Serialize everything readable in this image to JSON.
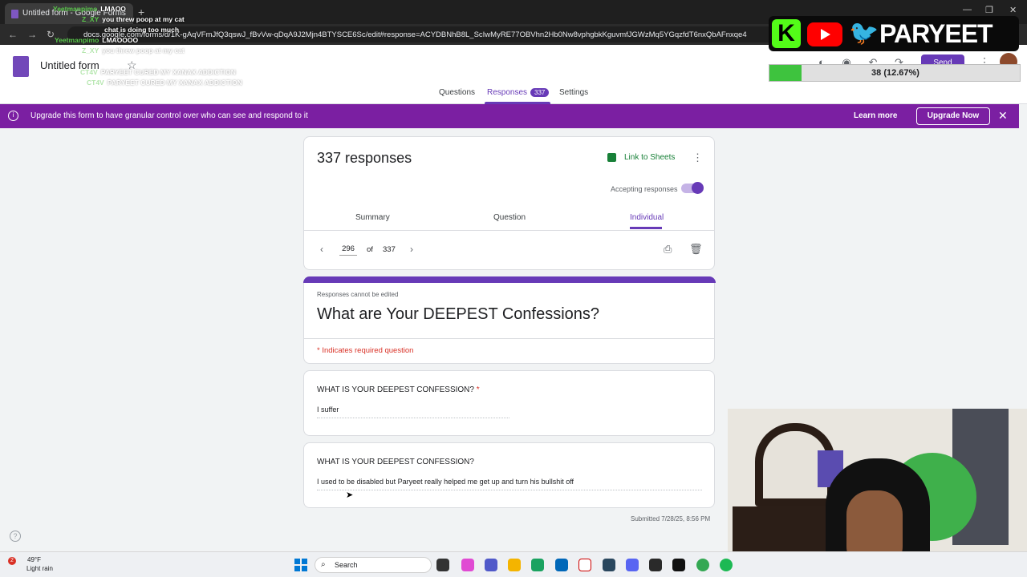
{
  "browser": {
    "tab_title": "Untitled form - Google Forms",
    "url": "docs.google.com/forms/d/1K-gAqVFmJfQ3qswJ_fBvVw-qDqA9J2Mjn4BTYSCE6Sc/edit#response=ACYDBNhB8L_ScIwMyRE77OBVhn2Hb0Nw8vphgbkKguvmfJGWzMq5YGqzfdT6nxQbAFnxqe4"
  },
  "forms_header": {
    "title": "Untitled form",
    "send_label": "Send",
    "tabs": [
      {
        "label": "Questions"
      },
      {
        "label": "Responses",
        "count": "337"
      },
      {
        "label": "Settings"
      }
    ]
  },
  "banner": {
    "message": "Upgrade this form to have granular control over who can see and respond to it",
    "learn_more": "Learn more",
    "upgrade": "Upgrade Now"
  },
  "summary_card": {
    "title": "337 responses",
    "link_sheets": "Link to Sheets",
    "accepting": "Accepting responses",
    "subtabs": [
      "Summary",
      "Question",
      "Individual"
    ],
    "pager": {
      "current": "296",
      "of": "of",
      "total": "337"
    }
  },
  "form_card": {
    "note": "Responses cannot be edited",
    "title": "What are Your DEEPEST Confessions?",
    "required_note": "* Indicates required question"
  },
  "questions": [
    {
      "label": "WHAT IS YOUR DEEPEST CONFESSION?",
      "required_mark": "*",
      "answer": "I suffer"
    },
    {
      "label": "WHAT IS YOUR DEEPEST CONFESSION?",
      "required_mark": "",
      "answer": "I used to be disabled but Paryeet really helped me get up and turn his bullshit off"
    }
  ],
  "submitted": "Submitted 7/28/25, 8:56 PM",
  "chat": [
    {
      "user": "Yeetmanpimo",
      "msg": "LMAOO"
    },
    {
      "user": "Z_XY",
      "msg": "you threw poop at my cat"
    },
    {
      "user": "",
      "msg": "chat is doing too much"
    },
    {
      "user": "Yeetmanpimo",
      "msg": "LMAOOOO"
    },
    {
      "user": "Z_XY",
      "msg": "you threw poop at my cat"
    },
    {
      "user": "CT4V",
      "msg": "PARYEET CURED MY XANAX ADDICTION"
    },
    {
      "user": "CT4V",
      "msg": "PARYEET CURED MY XANAX ADDICTION"
    }
  ],
  "overlay": {
    "brand_k": "K",
    "brand_name": "PARYEET",
    "goal_text": "38 (12.67%)",
    "goal_progress": 0.1267
  },
  "taskbar": {
    "weather_badge": "2",
    "temperature": "49°F",
    "condition": "Light rain",
    "search_placeholder": "Search"
  },
  "colors": {
    "accent": "#673ab7",
    "banner": "#7b1fa2",
    "required": "#d93025",
    "sheets": "#188038"
  }
}
